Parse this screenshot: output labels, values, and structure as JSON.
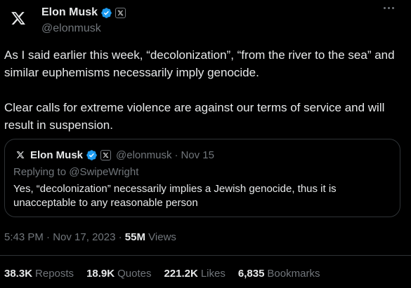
{
  "colors": {
    "background": "#000000",
    "text": "#e7e9ea",
    "muted": "#71767b",
    "border": "#2f3336",
    "verified": "#1d9bf0"
  },
  "icons": {
    "avatar": "x-logo-icon",
    "verified": "verified-badge-icon",
    "affiliation": "x-affiliation-icon",
    "more": "more-options-icon"
  },
  "author": {
    "display_name": "Elon Musk",
    "handle": "@elonmusk"
  },
  "tweet": {
    "paragraph_1": "As I said earlier this week, “decolonization”, “from the river to the sea” and similar euphemisms necessarily imply genocide.",
    "paragraph_2": "Clear calls for extreme violence are against our terms of service and will result in suspension."
  },
  "quote": {
    "display_name": "Elon Musk",
    "handle": "@elonmusk",
    "separator": "·",
    "date": "Nov 15",
    "replying_to": "Replying to @SwipeWright",
    "text": "Yes, “decolonization” necessarily implies a Jewish genocide, thus it is unacceptable to any reasonable person"
  },
  "meta": {
    "time": "5:43 PM",
    "separator_1": "·",
    "date": "Nov 17, 2023",
    "separator_2": "·",
    "views_count": "55M",
    "views_label": "Views"
  },
  "stats": [
    {
      "count": "38.3K",
      "label": "Reposts"
    },
    {
      "count": "18.9K",
      "label": "Quotes"
    },
    {
      "count": "221.2K",
      "label": "Likes"
    },
    {
      "count": "6,835",
      "label": "Bookmarks"
    }
  ]
}
